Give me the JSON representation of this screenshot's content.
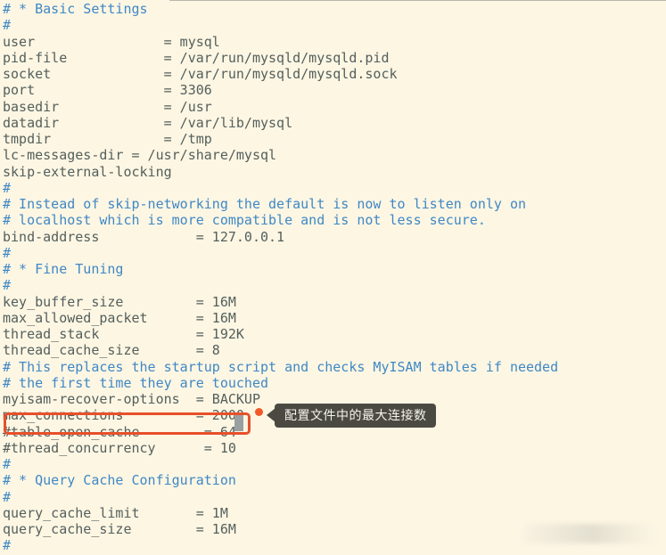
{
  "editor": {
    "file_type": "mysql-config",
    "background_color": "#fdf6e3",
    "comment_color": "#3f88c5",
    "text_color": "#54605d",
    "lines": [
      {
        "text": "# * Basic Settings",
        "kind": "comment"
      },
      {
        "text": "#",
        "kind": "comment"
      },
      {
        "text": "user                = mysql",
        "kind": "setting"
      },
      {
        "text": "pid-file            = /var/run/mysqld/mysqld.pid",
        "kind": "setting"
      },
      {
        "text": "socket              = /var/run/mysqld/mysqld.sock",
        "kind": "setting"
      },
      {
        "text": "port                = 3306",
        "kind": "setting"
      },
      {
        "text": "basedir             = /usr",
        "kind": "setting"
      },
      {
        "text": "datadir             = /var/lib/mysql",
        "kind": "setting"
      },
      {
        "text": "tmpdir              = /tmp",
        "kind": "setting"
      },
      {
        "text": "lc-messages-dir = /usr/share/mysql",
        "kind": "setting"
      },
      {
        "text": "skip-external-locking",
        "kind": "setting"
      },
      {
        "text": "#",
        "kind": "comment"
      },
      {
        "text": "# Instead of skip-networking the default is now to listen only on",
        "kind": "comment"
      },
      {
        "text": "# localhost which is more compatible and is not less secure.",
        "kind": "comment"
      },
      {
        "text": "bind-address            = 127.0.0.1",
        "kind": "setting"
      },
      {
        "text": "#",
        "kind": "comment"
      },
      {
        "text": "# * Fine Tuning",
        "kind": "comment"
      },
      {
        "text": "#",
        "kind": "comment"
      },
      {
        "text": "key_buffer_size         = 16M",
        "kind": "setting"
      },
      {
        "text": "max_allowed_packet      = 16M",
        "kind": "setting"
      },
      {
        "text": "thread_stack            = 192K",
        "kind": "setting"
      },
      {
        "text": "thread_cache_size       = 8",
        "kind": "setting"
      },
      {
        "text": "# This replaces the startup script and checks MyISAM tables if needed",
        "kind": "comment"
      },
      {
        "text": "# the first time they are touched",
        "kind": "comment"
      },
      {
        "text": "myisam-recover-options  = BACKUP",
        "kind": "setting"
      },
      {
        "text": "max_connections         = 2000",
        "kind": "setting"
      },
      {
        "text": "#table_open_cache        = 64",
        "kind": "setting"
      },
      {
        "text": "#thread_concurrency      = 10",
        "kind": "setting"
      },
      {
        "text": "#",
        "kind": "comment"
      },
      {
        "text": "# * Query Cache Configuration",
        "kind": "comment"
      },
      {
        "text": "#",
        "kind": "comment"
      },
      {
        "text": "query_cache_limit       = 1M",
        "kind": "setting"
      },
      {
        "text": "query_cache_size        = 16M",
        "kind": "setting"
      },
      {
        "text": "#",
        "kind": "comment"
      }
    ]
  },
  "annotation": {
    "highlight_box_color": "#e8502a",
    "marker_dot_color": "#f05a28",
    "tooltip_background": "#4b4a42",
    "tooltip_text_color": "#f4f2ec",
    "tooltip_text": "配置文件中的最大连接数",
    "highlighted_line": "max_connections         = 2000",
    "cursor_color": "#9aa0a0"
  }
}
